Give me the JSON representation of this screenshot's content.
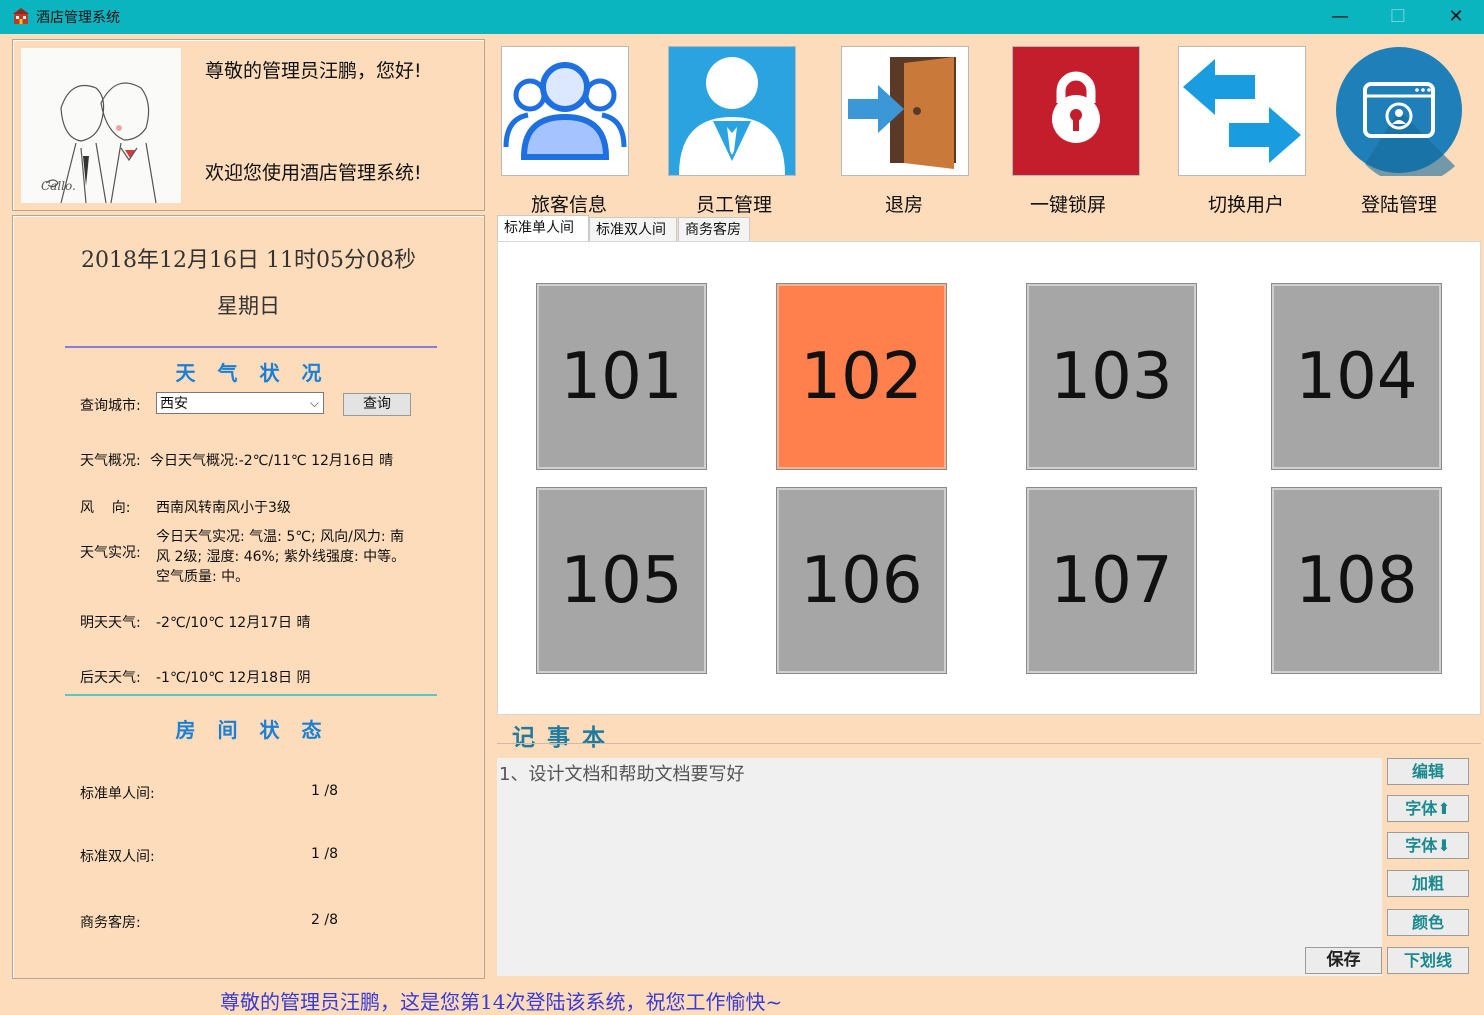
{
  "window": {
    "title": "酒店管理系统",
    "min_icon": "—",
    "max_icon": "☐",
    "close_icon": "✕"
  },
  "welcome": {
    "greeting": "尊敬的管理员汪鹏，您好!",
    "message": "欢迎您使用酒店管理系统!"
  },
  "clock": {
    "date_time": "2018年12月16日  11时05分08秒",
    "weekday": "星期日"
  },
  "weather": {
    "section_title": "天气状况",
    "city_label": "查询城市:",
    "city_value": "西安",
    "query_button": "查询",
    "overview_label": "天气概况:",
    "overview_value": "今日天气概况:-2℃/11℃  12月16日  晴",
    "wind_label": "风    向:",
    "wind_value": "西南风转南风小于3级",
    "live_label": "天气实况:",
    "live_value": "今日天气实况: 气温: 5℃; 风向/风力: 南风 2级; 湿度: 46%; 紫外线强度: 中等。空气质量: 中。",
    "tomorrow_label": "明天天气:",
    "tomorrow_value": "-2℃/10℃  12月17日  晴",
    "after_label": "后天天气:",
    "after_value": "-1℃/10℃  12月18日  阴"
  },
  "room_status": {
    "section_title": "房间状态",
    "items": [
      {
        "label": "标准单人间:",
        "value": "1 /8"
      },
      {
        "label": "标准双人间:",
        "value": "1 /8"
      },
      {
        "label": "商务客房:",
        "value": "2 /8"
      }
    ]
  },
  "toolbar": [
    {
      "label": "旅客信息",
      "icon": "users-icon"
    },
    {
      "label": "员工管理",
      "icon": "employee-icon"
    },
    {
      "label": "退房",
      "icon": "checkout-door-icon"
    },
    {
      "label": "一键锁屏",
      "icon": "lock-icon"
    },
    {
      "label": "切换用户",
      "icon": "switch-arrows-icon"
    },
    {
      "label": "登陆管理",
      "icon": "login-manage-icon"
    }
  ],
  "tabs": [
    "标准单人间",
    "标准双人间",
    "商务客房"
  ],
  "rooms": [
    {
      "number": "101",
      "occupied": false
    },
    {
      "number": "102",
      "occupied": true
    },
    {
      "number": "103",
      "occupied": false
    },
    {
      "number": "104",
      "occupied": false
    },
    {
      "number": "105",
      "occupied": false
    },
    {
      "number": "106",
      "occupied": false
    },
    {
      "number": "107",
      "occupied": false
    },
    {
      "number": "108",
      "occupied": false
    }
  ],
  "notepad": {
    "title": "记事本",
    "content": "1、设计文档和帮助文档要写好",
    "buttons": {
      "edit": "编辑",
      "font_up": "字体⬆",
      "font_down": "字体⬇",
      "bold": "加粗",
      "color": "颜色",
      "underline": "下划线",
      "save": "保存"
    }
  },
  "status_bar": "尊敬的管理员汪鹏，这是您第14次登陆该系统，祝您工作愉快~",
  "colors": {
    "titlebar": "#0bb5c0",
    "background": "#fcdcbb",
    "occupied": "#ff7f4d",
    "vacant": "#a6a6a6",
    "accent_blue": "#1a7fd6",
    "lock_red": "#c41e2c"
  }
}
